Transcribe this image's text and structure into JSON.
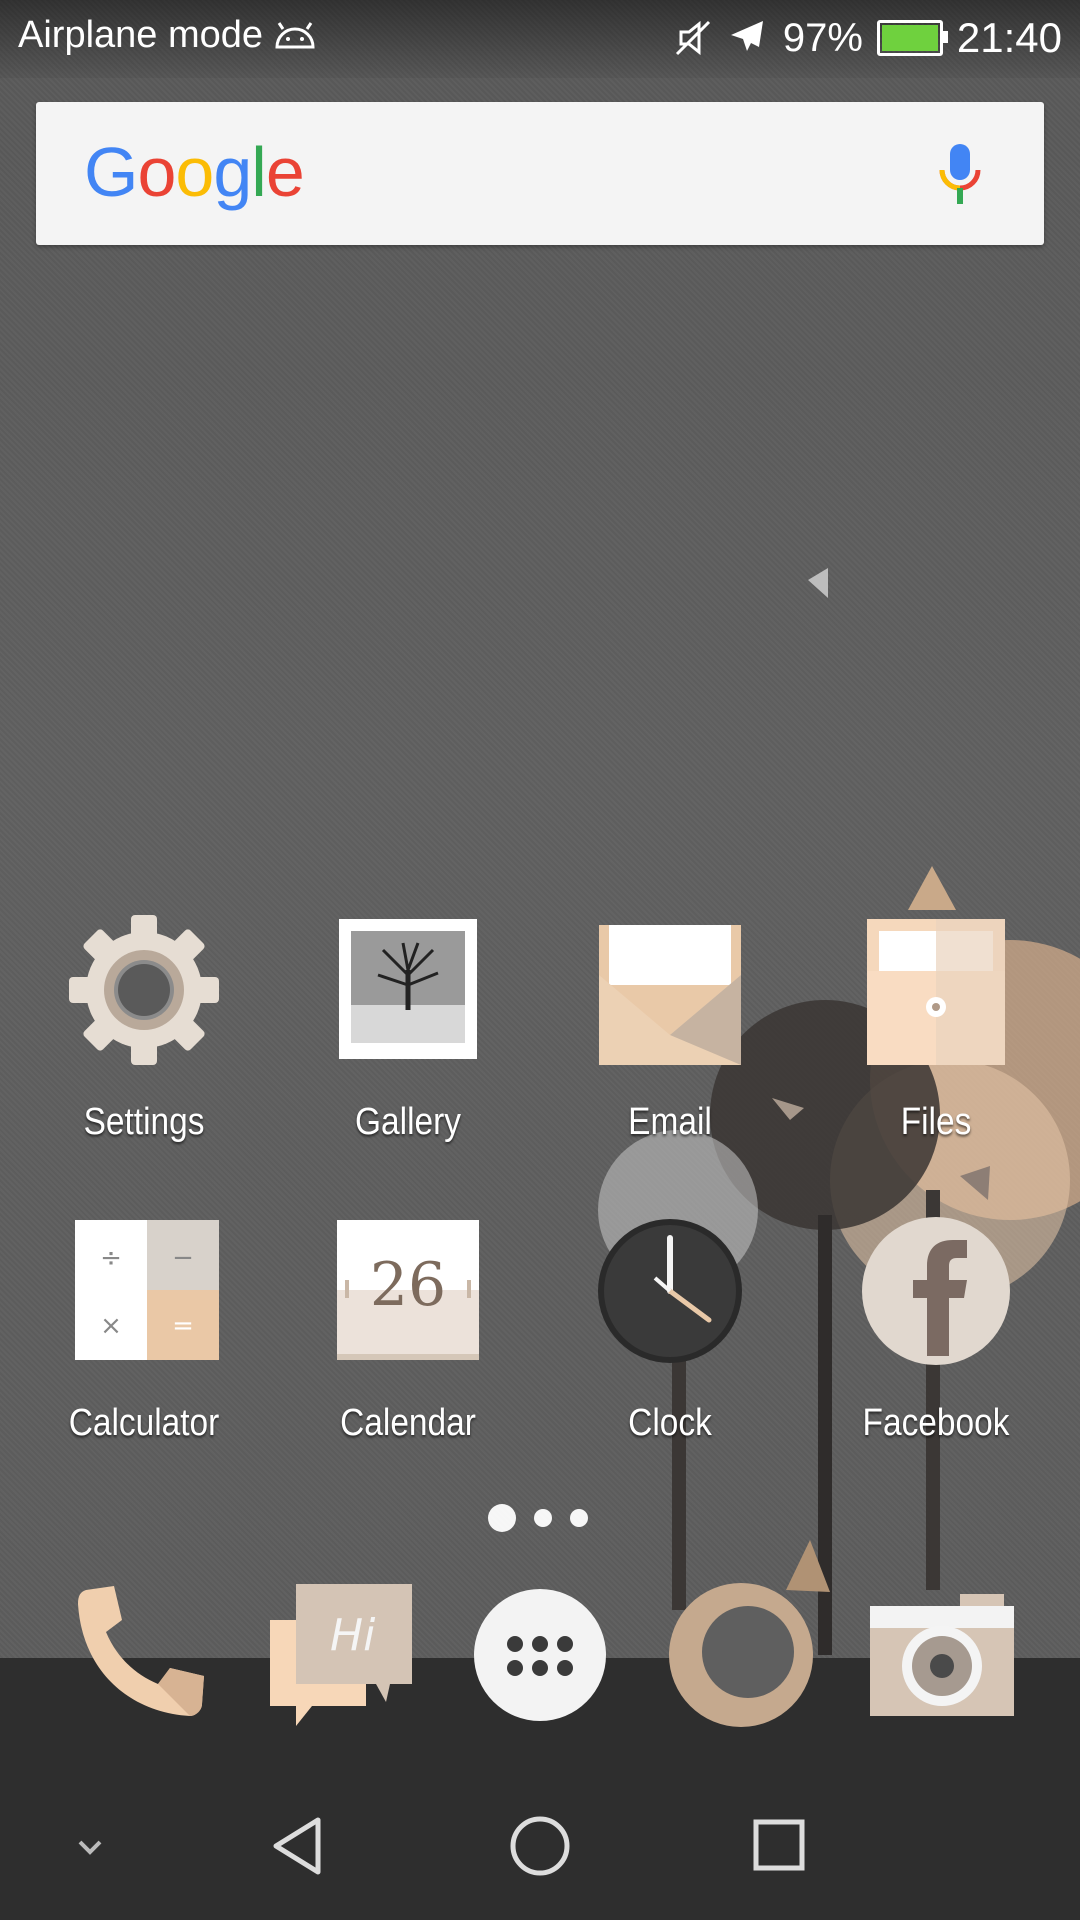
{
  "status_bar": {
    "mode_text": "Airplane mode",
    "battery_percent": "97%",
    "time": "21:40",
    "icons": [
      "android-icon",
      "mute-icon",
      "airplane-icon",
      "battery-charging-icon"
    ],
    "battery_fill_color": "#6fd13e"
  },
  "search": {
    "logo_text": "Google",
    "icons": [
      "mic-icon"
    ]
  },
  "apps": [
    {
      "label": "Settings",
      "icon": "settings-icon"
    },
    {
      "label": "Gallery",
      "icon": "gallery-icon"
    },
    {
      "label": "Email",
      "icon": "email-icon"
    },
    {
      "label": "Files",
      "icon": "files-icon"
    },
    {
      "label": "Calculator",
      "icon": "calculator-icon"
    },
    {
      "label": "Calendar",
      "icon": "calendar-icon",
      "date": "26"
    },
    {
      "label": "Clock",
      "icon": "clock-icon"
    },
    {
      "label": "Facebook",
      "icon": "facebook-icon"
    }
  ],
  "pager": {
    "pages": 3,
    "active_index": 0
  },
  "dock": {
    "icons": [
      "phone-icon",
      "messaging-icon",
      "app-drawer-icon",
      "browser-icon",
      "camera-icon"
    ],
    "messaging_text": "Hi"
  },
  "navbar": {
    "icons": [
      "collapse-chevron-icon",
      "back-icon",
      "home-icon",
      "recents-icon"
    ]
  },
  "colors": {
    "theme_beige": "#e9c9a8",
    "theme_taupe": "#c8b8a8",
    "wallpaper_gray": "#5d5d5d",
    "dock_dark": "#2e2e2e"
  }
}
